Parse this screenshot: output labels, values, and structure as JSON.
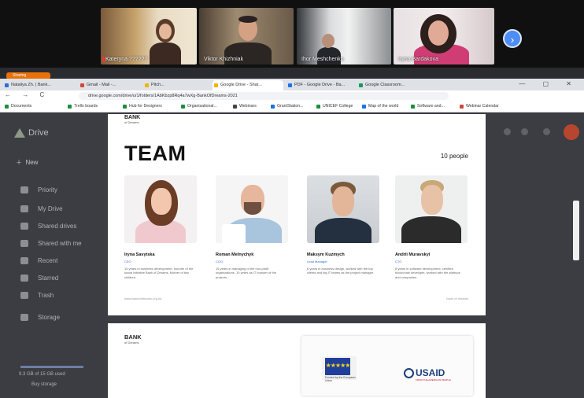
{
  "call": {
    "participants": [
      {
        "name": "Kateryna ??????"
      },
      {
        "name": "Viktor Khizhniak"
      },
      {
        "name": "Ihor Meshchenko"
      },
      {
        "name": "Iryna Bardakova"
      }
    ],
    "more_icon": "chevron-right-icon"
  },
  "browser": {
    "share_badge": "Sharing",
    "tabs": [
      "Nataliya Zh. | Bank...",
      "Gmail - Mail -...",
      "Pitch...",
      "Google Drive - Shar...",
      "PDF - Google Drive - Ba...",
      "Google Classroom..."
    ],
    "active_tab": "Google Drive - Shar...",
    "window_controls": "— ▢ ✕",
    "nav": "← → C",
    "url": "drive.google.com/drive/u/1/folders/1AbKbzp8Rq4a7wXg-BankOfDreams-2021",
    "bookmarks": [
      "Documents",
      "Trello boards",
      "Hub for Designers",
      "Organisational...",
      "Webinars",
      "GrantStation...",
      "UNICEF College",
      "Map of the world",
      "Software and...",
      "Webinar Calendar"
    ]
  },
  "drive": {
    "logo": "Drive",
    "new_label": "New",
    "sidebar": [
      "Priority",
      "My Drive",
      "Shared drives",
      "Shared with me",
      "Recent",
      "Starred",
      "Trash",
      "Storage"
    ],
    "storage_text": "9.3 GB of 15 GB used",
    "buy_storage": "Buy storage"
  },
  "team_slide": {
    "brand": "BANK",
    "brand_sub": "of Dreams",
    "title": "TEAM",
    "count": "10 people",
    "members": [
      {
        "name": "Iryna Savytska",
        "role": "CEO",
        "bio": "15 years in business development, founder of the social initiative Bank of Dreams. Mother of two children."
      },
      {
        "name": "Roman Melnychyk",
        "role": "COO",
        "bio": "15 years in managing of the non-profit organizations, 10 years as IT founder of the projects."
      },
      {
        "name": "Maksym Kuzmych",
        "role": "Lead Manager",
        "bio": "6 years in business design, worked with the top clients and big IT teams as the project manager."
      },
      {
        "name": "Andrii Muravskyi",
        "role": "CTO",
        "bio": "8 years in software development, certified blockchain developer, worked with the startups and companies."
      }
    ],
    "footer_left": "www.bankofdreams.org.ua",
    "footer_right": "bank of dreams"
  },
  "partners_slide": {
    "brand": "BANK",
    "brand_sub": "of Dreams",
    "eu_caption": "Funded by the European Union",
    "usaid": "USAID",
    "usaid_sub": "FROM THE AMERICAN PEOPLE"
  }
}
